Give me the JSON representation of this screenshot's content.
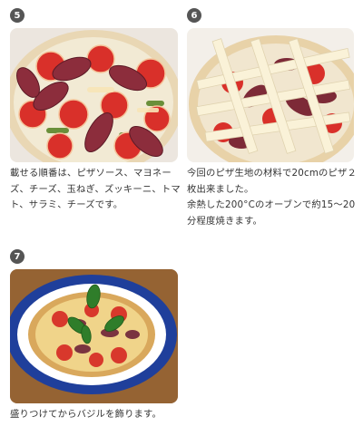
{
  "steps": [
    {
      "number": "5",
      "image": "pizza-toppings-photo",
      "text": "載せる順番は、ピザソース、マヨネーズ、チーズ、玉ねぎ、ズッキーニ、トマト、サラミ、チーズです。"
    },
    {
      "number": "6",
      "image": "pizza-cheese-lattice-photo",
      "lines": [
        "今回のピザ生地の材料で20cmのピザ２枚出来ました。",
        "余熱した200°Cのオーブンで約15〜20分程度焼きます。"
      ]
    },
    {
      "number": "7",
      "image": "baked-pizza-basil-photo",
      "text": "盛りつけてからバジルを飾ります。"
    }
  ]
}
